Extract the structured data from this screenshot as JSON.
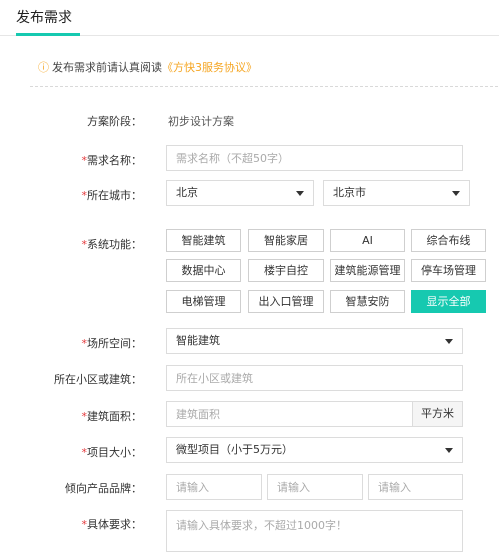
{
  "header": {
    "title": "发布需求"
  },
  "notice": {
    "icon": "info-circle-icon",
    "text": "发布需求前请认真阅读",
    "link": "《方快3服务协议》",
    "icon_color": "#f5a623"
  },
  "accent_color": "#16c9b0",
  "form": {
    "stage": {
      "label": "方案阶段：",
      "value": "初步设计方案"
    },
    "name": {
      "label": "需求名称：",
      "placeholder": "需求名称（不超50字）"
    },
    "city": {
      "label": "所在城市：",
      "province": "北京",
      "city": "北京市"
    },
    "functions": {
      "label": "系统功能：",
      "options": [
        "智能建筑",
        "智能家居",
        "AI",
        "综合布线",
        "数据中心",
        "楼宇自控",
        "建筑能源管理",
        "停车场管理",
        "电梯管理",
        "出入口管理",
        "智慧安防"
      ],
      "show_all": "显示全部"
    },
    "space": {
      "label": "场所空间：",
      "value": "智能建筑"
    },
    "building": {
      "label": "所在小区或建筑：",
      "placeholder": "所在小区或建筑"
    },
    "area": {
      "label": "建筑面积：",
      "placeholder": "建筑面积",
      "unit": "平方米"
    },
    "size": {
      "label": "项目大小：",
      "value": "微型项目（小于5万元）"
    },
    "brand": {
      "label": "倾向产品品牌：",
      "placeholders": [
        "请输入",
        "请输入",
        "请输入"
      ]
    },
    "requirement": {
      "label": "具体要求：",
      "placeholder": "请输入具体要求，不超过1000字！"
    }
  }
}
